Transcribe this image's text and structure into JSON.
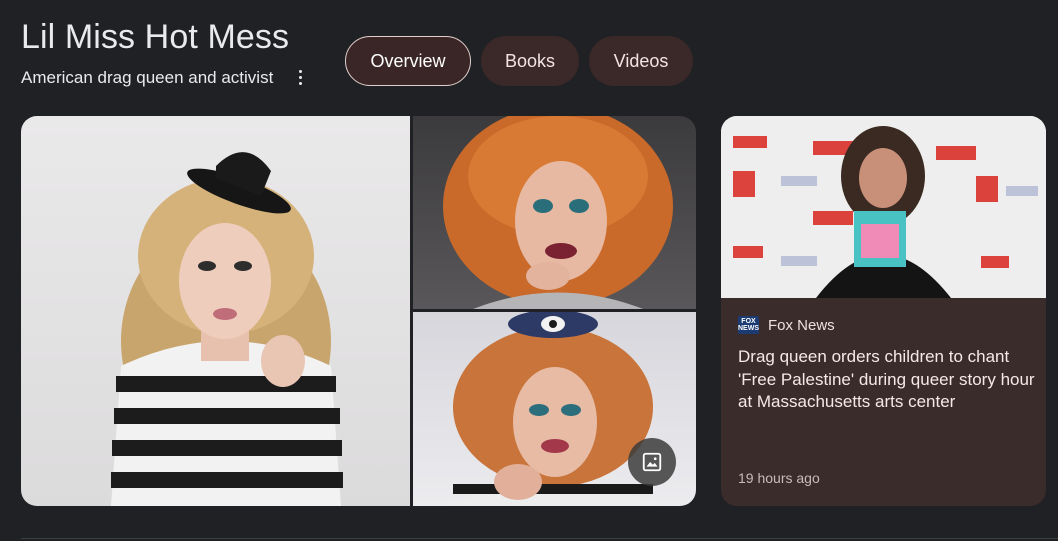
{
  "entity": {
    "title": "Lil Miss Hot Mess",
    "subtitle": "American drag queen and activist"
  },
  "chips": [
    {
      "label": "Overview",
      "active": true
    },
    {
      "label": "Books",
      "active": false
    },
    {
      "label": "Videos",
      "active": false
    }
  ],
  "gallery": {
    "more_images_icon": "image-icon"
  },
  "news": {
    "source": "Fox News",
    "source_logo_text": "FOX NEWS",
    "headline": "Drag queen orders children to chant 'Free Palestine' during queer story hour at Massachusetts arts center",
    "time": "19 hours ago"
  },
  "colors": {
    "background": "#202124",
    "chip_bg": "#3b2828",
    "card_bg": "#3b2c2c",
    "text": "#e8eaed"
  }
}
